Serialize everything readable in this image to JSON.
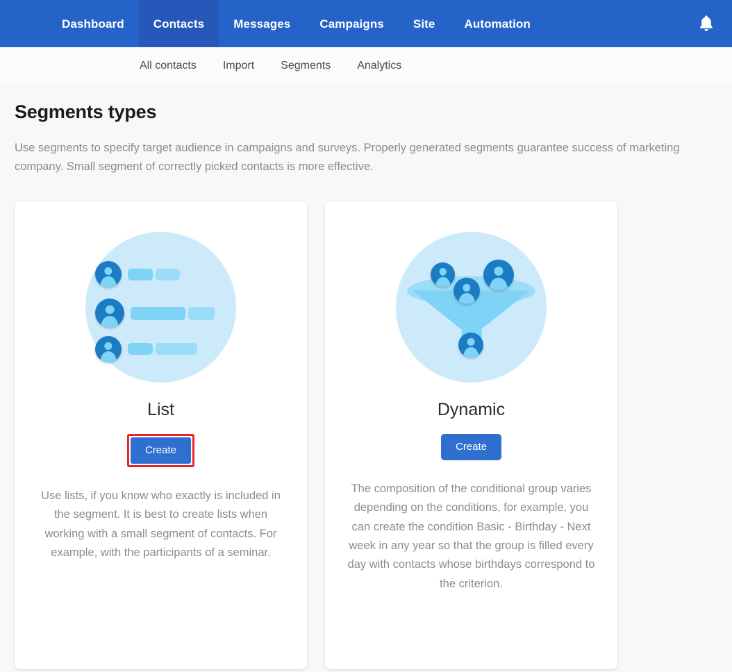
{
  "topnav": {
    "brand_color": "#2563c9",
    "active_color": "#2558b8",
    "items": [
      {
        "label": "Dashboard",
        "active": false
      },
      {
        "label": "Contacts",
        "active": true
      },
      {
        "label": "Messages",
        "active": false
      },
      {
        "label": "Campaigns",
        "active": false
      },
      {
        "label": "Site",
        "active": false
      },
      {
        "label": "Automation",
        "active": false
      }
    ],
    "notification_icon": "bell-icon"
  },
  "subnav": {
    "items": [
      {
        "label": "All contacts"
      },
      {
        "label": "Import"
      },
      {
        "label": "Segments"
      },
      {
        "label": "Analytics"
      }
    ]
  },
  "page": {
    "title": "Segments types",
    "description": "Use segments to specify target audience in campaigns and surveys. Properly generated segments guarantee success of marketing company. Small segment of correctly picked contacts is more effective."
  },
  "cards": [
    {
      "id": "list",
      "title": "List",
      "illustration": "list-contacts-icon",
      "button_label": "Create",
      "button_highlighted": true,
      "highlight_color": "#ef2222",
      "description": "Use lists, if you know who exactly is included in the segment. It is best to create lists when working with a small segment of contacts. For example, with the participants of a seminar."
    },
    {
      "id": "dynamic",
      "title": "Dynamic",
      "illustration": "funnel-contacts-icon",
      "button_label": "Create",
      "button_highlighted": false,
      "description": "The composition of the conditional group varies depending on the conditions, for example, you can create the condition Basic - Birthday - Next week in any year so that the group is filled every day with contacts whose birthdays correspond to the criterion."
    }
  ],
  "theme": {
    "page_background": "#f8f8f9",
    "card_background": "#ffffff",
    "button_color": "#2f6fd0",
    "illustration_bg": "#cdeafb",
    "illustration_dark": "#1b7cc4",
    "illustration_light": "#7fd3f7",
    "muted_text": "#8c8c8c"
  }
}
